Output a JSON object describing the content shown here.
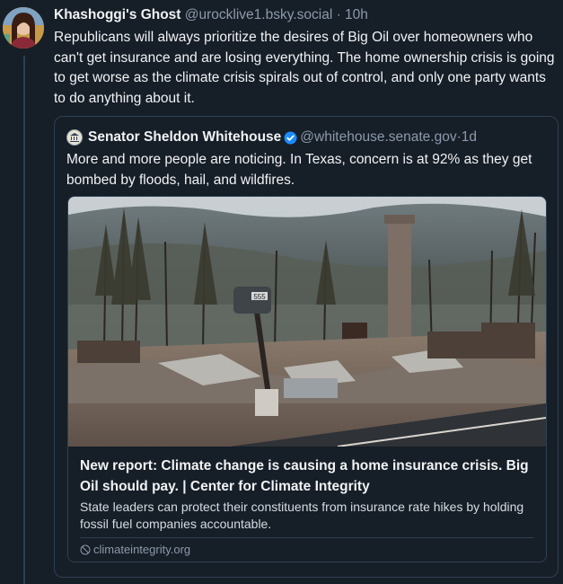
{
  "post": {
    "author_name": "Khashoggi's Ghost",
    "author_handle": "@urocklive1.bsky.social",
    "separator": " · ",
    "time": "10h",
    "text": "Republicans will always prioritize the desires of Big Oil over homeowners who can't get insurance and are losing everything. The home ownership crisis is going to get worse as the climate crisis spirals out of control, and only one party wants to do anything about it."
  },
  "quote": {
    "author_name": "Senator Sheldon Whitehouse",
    "author_handle": "@whitehouse.senate.gov",
    "separator": " · ",
    "time": "1d",
    "text": "More and more people are noticing. In Texas, concern is at 92% as they get bombed by floods, hail, and wildfires.",
    "card": {
      "title": "New report: Climate change is causing a home insurance crisis. Big Oil should pay. | Center for Climate Integrity",
      "description": "State leaders can protect their constituents from insurance rate hikes by holding fossil fuel companies accountable.",
      "domain": "climateintegrity.org",
      "image_mailbox_number": "555"
    }
  },
  "icons": {
    "verified": "verified-badge-icon",
    "globe": "globe-icon"
  },
  "colors": {
    "background": "#161e27",
    "border": "#2e4052",
    "muted_text": "#8c9aab",
    "verified_blue": "#1a8cff"
  }
}
